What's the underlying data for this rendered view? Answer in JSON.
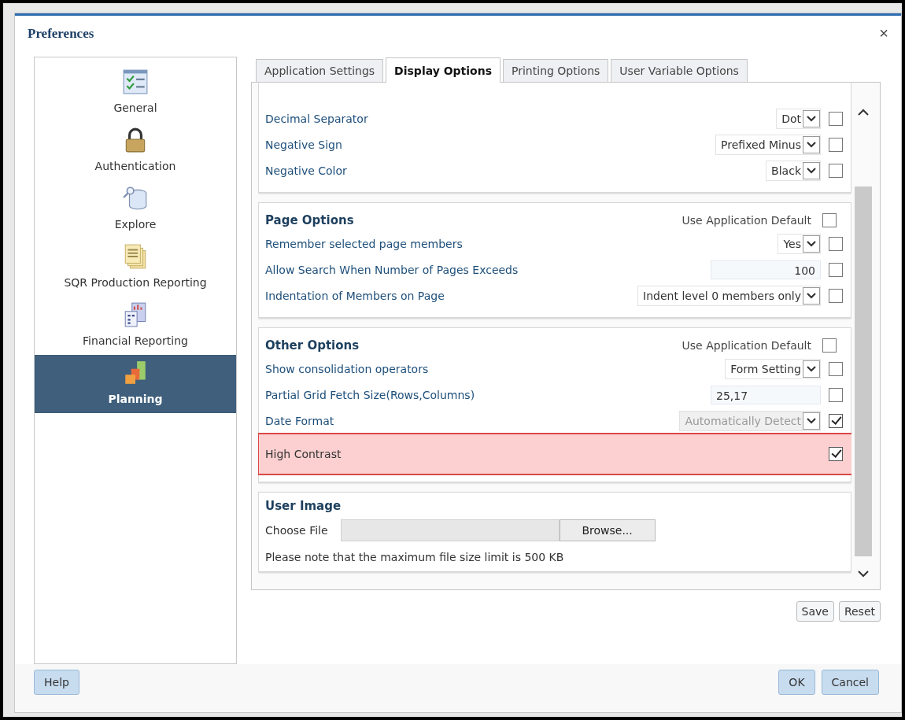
{
  "window": {
    "title": "Preferences",
    "close": "×"
  },
  "sidebar": {
    "items": [
      {
        "label": "General",
        "selected": false
      },
      {
        "label": "Authentication",
        "selected": false
      },
      {
        "label": "Explore",
        "selected": false
      },
      {
        "label": "SQR Production Reporting",
        "selected": false
      },
      {
        "label": "Financial Reporting",
        "selected": false
      },
      {
        "label": "Planning",
        "selected": true
      }
    ]
  },
  "tabs": [
    {
      "label": "Application Settings",
      "selected": false
    },
    {
      "label": "Display Options",
      "selected": true
    },
    {
      "label": "Printing Options",
      "selected": false
    },
    {
      "label": "User Variable Options",
      "selected": false
    }
  ],
  "sections": [
    {
      "rows": [
        {
          "label": "Decimal Separator",
          "kind": "select",
          "value": "Dot",
          "disabled": false,
          "checked": false,
          "highlighted": false
        },
        {
          "label": "Negative Sign",
          "kind": "select",
          "value": "Prefixed Minus",
          "disabled": false,
          "checked": false,
          "highlighted": false
        },
        {
          "label": "Negative Color",
          "kind": "select",
          "value": "Black",
          "disabled": false,
          "checked": false,
          "highlighted": false
        }
      ]
    },
    {
      "title": "Page Options",
      "default_label": "Use Application Default",
      "default_checked": false,
      "rows": [
        {
          "label": "Remember selected page members",
          "kind": "select",
          "value": "Yes",
          "disabled": false,
          "checked": false,
          "highlighted": false
        },
        {
          "label": "Allow Search When Number of Pages Exceeds",
          "kind": "number",
          "value": "100",
          "checked": false,
          "highlighted": false
        },
        {
          "label": "Indentation of Members on Page",
          "kind": "select",
          "value": "Indent level 0 members only",
          "disabled": false,
          "checked": false,
          "highlighted": false
        }
      ]
    },
    {
      "title": "Other Options",
      "default_label": "Use Application Default",
      "default_checked": false,
      "rows": [
        {
          "label": "Show consolidation operators",
          "kind": "select",
          "value": "Form Setting",
          "disabled": false,
          "checked": false,
          "highlighted": false
        },
        {
          "label": "Partial Grid Fetch Size(Rows,Columns)",
          "kind": "text",
          "value": "25,17",
          "checked": false,
          "highlighted": false
        },
        {
          "label": "Date Format",
          "kind": "select",
          "value": "Automatically Detect",
          "disabled": true,
          "checked": true,
          "highlighted": false
        },
        {
          "label": "High Contrast",
          "kind": "plain",
          "checked": true,
          "highlighted": true
        }
      ]
    }
  ],
  "user_image": {
    "title": "User Image",
    "choose_label": "Choose File",
    "browse": "Browse...",
    "note": "Please note that the maximum file size limit is 500 KB"
  },
  "panel_buttons": [
    "Save",
    "Reset"
  ],
  "footer": {
    "help": "Help",
    "buttons": [
      "OK",
      "Cancel"
    ]
  }
}
